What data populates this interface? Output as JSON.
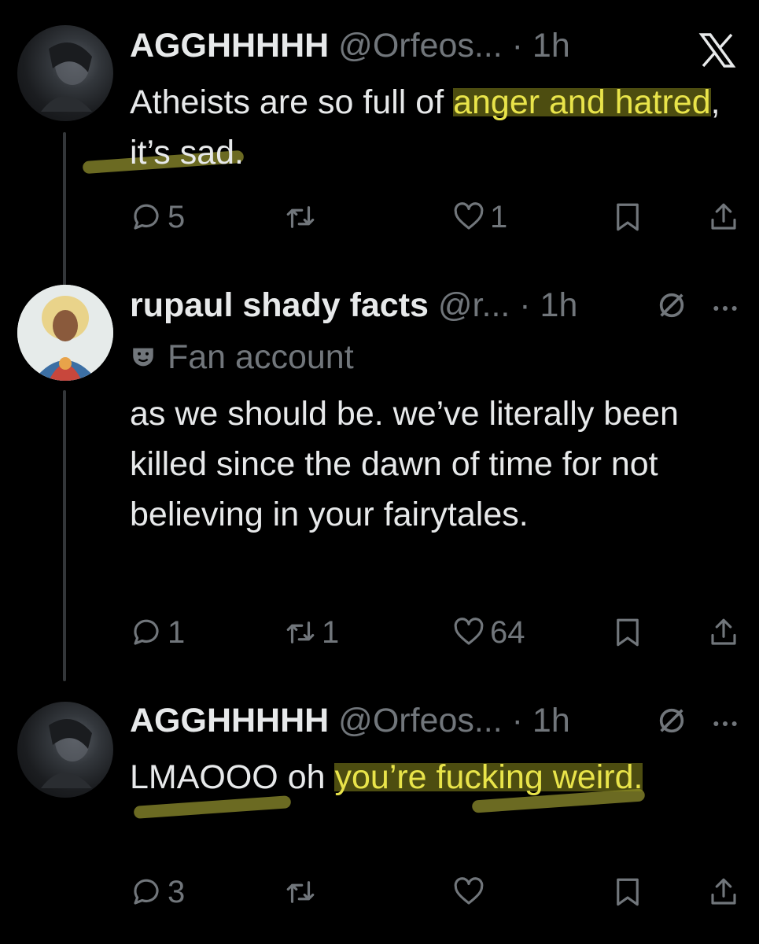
{
  "tweets": [
    {
      "name": "AGGHHHHH",
      "meta": "@Orfeos... · 1h",
      "text_before": "Atheists are so full of ",
      "text_highlight": "anger and hatred",
      "text_after": ", it’s sad.",
      "actions": {
        "replies": "5",
        "retweets": "",
        "likes": "1"
      },
      "icons": {
        "reply": "reply-icon",
        "retweet": "retweet-icon",
        "like": "heart-icon",
        "bookmark": "bookmark-icon",
        "share": "share-icon",
        "brand": "x-logo-icon"
      }
    },
    {
      "name": "rupaul shady facts",
      "meta": "@r... · 1h",
      "badge": "Fan account",
      "text": "as we should be. we’ve literally been killed since the dawn of time for not believing in your fairytales.",
      "actions": {
        "replies": "1",
        "retweets": "1",
        "likes": "64"
      },
      "icons": {
        "badge": "theater-mask-icon",
        "muted": "slashed-circle-icon",
        "more": "more-icon"
      }
    },
    {
      "name": "AGGHHHHH",
      "meta": "@Orfeos... · 1h",
      "text_before": "LMAOOO oh ",
      "text_highlight": "you’re fucking weird.",
      "text_after": "",
      "actions": {
        "replies": "3",
        "retweets": "",
        "likes": ""
      },
      "icons": {
        "muted": "slashed-circle-icon",
        "more": "more-icon"
      }
    }
  ],
  "colors": {
    "background": "#000000",
    "text": "#e7e9ea",
    "muted": "#71767b",
    "highlight": "#e9e44a"
  }
}
